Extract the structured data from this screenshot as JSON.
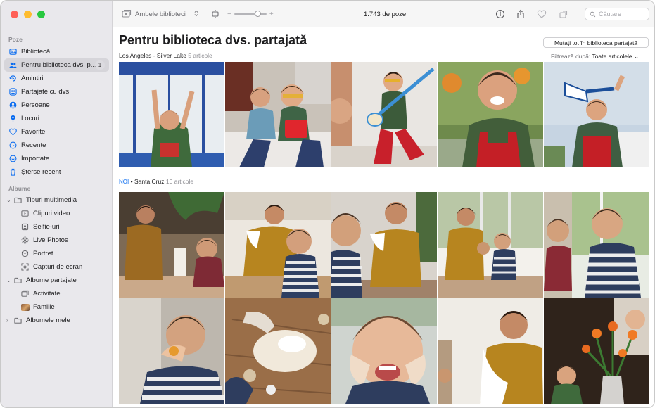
{
  "window": {
    "title": "Poze"
  },
  "sidebar": {
    "section_photos": "Poze",
    "items": [
      {
        "label": "Bibliotecă",
        "icon": "photo-library-icon"
      },
      {
        "label": "Pentru biblioteca dvs. p...",
        "icon": "people-icon",
        "badge": "1",
        "active": true
      },
      {
        "label": "Amintiri",
        "icon": "memories-icon"
      },
      {
        "label": "Partajate cu dvs.",
        "icon": "shared-with-you-icon"
      },
      {
        "label": "Persoane",
        "icon": "person-icon"
      },
      {
        "label": "Locuri",
        "icon": "map-pin-icon"
      },
      {
        "label": "Favorite",
        "icon": "heart-icon"
      },
      {
        "label": "Recente",
        "icon": "clock-icon"
      },
      {
        "label": "Importate",
        "icon": "import-icon"
      },
      {
        "label": "Șterse recent",
        "icon": "trash-icon"
      }
    ],
    "section_albums": "Albume",
    "media_types": {
      "label": "Tipuri multimedia",
      "items": [
        {
          "label": "Clipuri video",
          "icon": "video-icon"
        },
        {
          "label": "Selfie-uri",
          "icon": "selfie-icon"
        },
        {
          "label": "Live Photos",
          "icon": "live-photo-icon"
        },
        {
          "label": "Portret",
          "icon": "portrait-cube-icon"
        },
        {
          "label": "Capturi de ecran",
          "icon": "screenshot-icon"
        }
      ]
    },
    "shared_albums": {
      "label": "Albume partajate",
      "items": [
        {
          "label": "Activitate",
          "icon": "activity-icon"
        },
        {
          "label": "Familie",
          "icon": "family-album-thumbnail"
        }
      ]
    },
    "my_albums": {
      "label": "Albumele mele"
    }
  },
  "toolbar": {
    "library_selector": "Ambele biblioteci",
    "photo_count": "1.743 de poze",
    "search_placeholder": "Căutare",
    "zoom_level": 0.74
  },
  "main": {
    "title": "Pentru biblioteca dvs. partajată",
    "move_all_button": "Mutați tot în biblioteca partajată",
    "filter_label": "Filtrează după:",
    "filter_value": "Toate articolele",
    "groups": [
      {
        "new": "",
        "location": "Los Angeles - Silver Lake",
        "count": "5 articole"
      },
      {
        "new": "NOI",
        "location": "Santa Cruz",
        "count": "10 articole"
      }
    ]
  },
  "colors": {
    "accent": "#0a6cf0",
    "sidebar_bg": "#e9e8ec",
    "selected_row": "#d6d5da"
  }
}
